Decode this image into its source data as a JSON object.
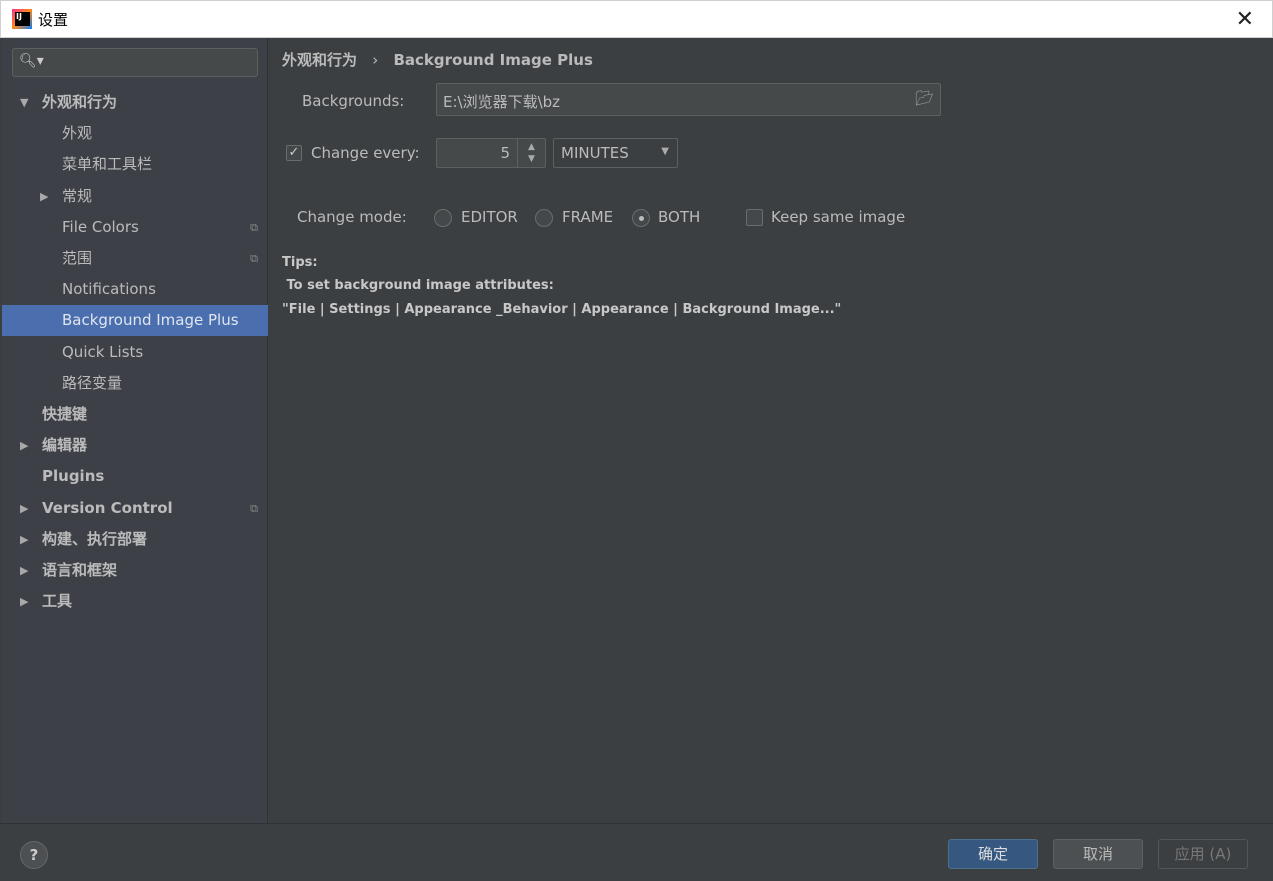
{
  "window": {
    "title": "设置",
    "close": "✕"
  },
  "sidebar": {
    "items": [
      {
        "label": "外观和行为",
        "level": 0,
        "arrow": "▼",
        "bold": true
      },
      {
        "label": "外观",
        "level": 1
      },
      {
        "label": "菜单和工具栏",
        "level": 1
      },
      {
        "label": "常规",
        "level": 1,
        "arrow": "▶"
      },
      {
        "label": "File Colors",
        "level": 1,
        "copy": true
      },
      {
        "label": "范围",
        "level": 1,
        "copy": true
      },
      {
        "label": "Notifications",
        "level": 1
      },
      {
        "label": "Background Image Plus",
        "level": 1,
        "selected": true
      },
      {
        "label": "Quick Lists",
        "level": 1
      },
      {
        "label": "路径变量",
        "level": 1
      },
      {
        "label": "快捷键",
        "level": 0,
        "bold": true
      },
      {
        "label": "编辑器",
        "level": 0,
        "arrow": "▶",
        "bold": true
      },
      {
        "label": "Plugins",
        "level": 0,
        "bold": true
      },
      {
        "label": "Version Control",
        "level": 0,
        "arrow": "▶",
        "bold": true,
        "copy": true
      },
      {
        "label": "构建、执行部署",
        "level": 0,
        "arrow": "▶",
        "bold": true
      },
      {
        "label": "语言和框架",
        "level": 0,
        "arrow": "▶",
        "bold": true
      },
      {
        "label": "工具",
        "level": 0,
        "arrow": "▶",
        "bold": true
      }
    ],
    "search_icon": "search-icon"
  },
  "breadcrumb": {
    "parent": "外观和行为",
    "sep": "›",
    "current": "Background Image Plus"
  },
  "form": {
    "backgrounds_label": "Backgrounds:",
    "backgrounds_value": "E:\\浏览器下载\\bz",
    "change_every_label": "Change every:",
    "change_every_checked": true,
    "change_every_value": "5",
    "unit": "MINUTES",
    "change_mode_label": "Change mode:",
    "modes": [
      "EDITOR",
      "FRAME",
      "BOTH"
    ],
    "selected_mode": "BOTH",
    "keep_same_label": "Keep same image",
    "keep_same_checked": false
  },
  "tips": {
    "title": "Tips:",
    "line1": " To set background image attributes:",
    "line2": "\"File | Settings | Appearance _Behavior | Appearance | Background Image...\""
  },
  "footer": {
    "help": "?",
    "ok": "确定",
    "cancel": "取消",
    "apply": "应用 (A)"
  },
  "colors": {
    "accent": "#4b6eaf",
    "ok_button": "#365880"
  }
}
